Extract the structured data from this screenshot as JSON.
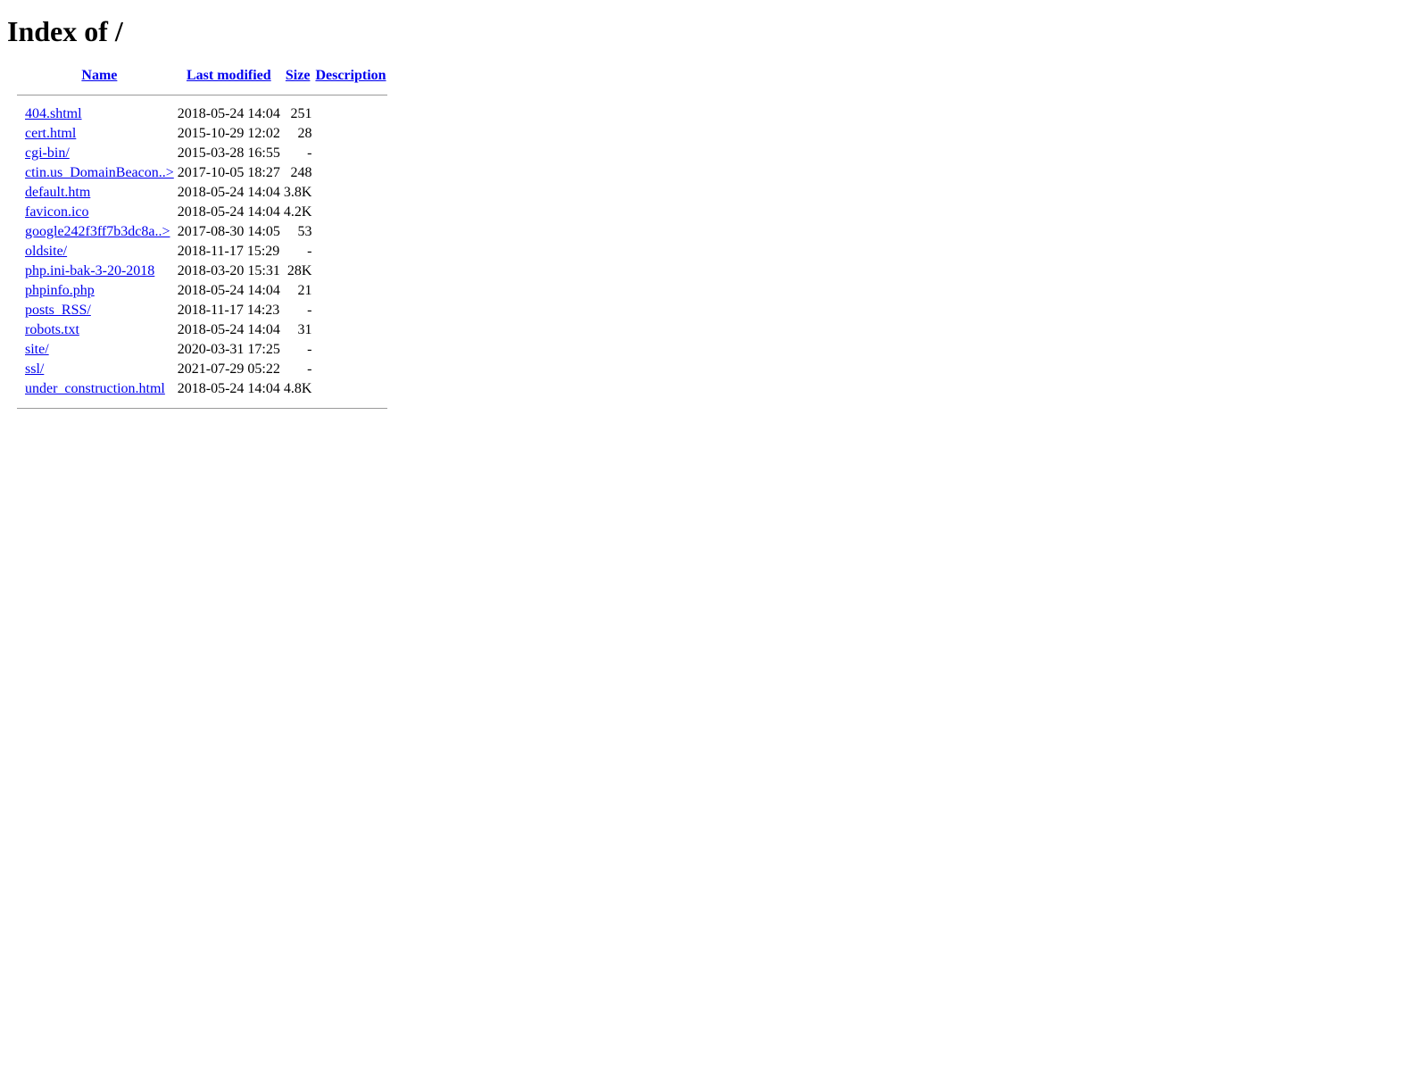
{
  "page": {
    "title": "Index of /"
  },
  "table": {
    "headers": {
      "name": "Name",
      "last_modified": "Last modified",
      "size": "Size",
      "description": "Description"
    },
    "rows": [
      {
        "name": "404.shtml",
        "modified": "2018-05-24 14:04",
        "size": "251",
        "description": ""
      },
      {
        "name": "cert.html",
        "modified": "2015-10-29 12:02",
        "size": "28",
        "description": ""
      },
      {
        "name": "cgi-bin/",
        "modified": "2015-03-28 16:55",
        "size": "-",
        "description": ""
      },
      {
        "name": "ctin.us_DomainBeacon..>",
        "modified": "2017-10-05 18:27",
        "size": "248",
        "description": ""
      },
      {
        "name": "default.htm",
        "modified": "2018-05-24 14:04",
        "size": "3.8K",
        "description": ""
      },
      {
        "name": "favicon.ico",
        "modified": "2018-05-24 14:04",
        "size": "4.2K",
        "description": ""
      },
      {
        "name": "google242f3ff7b3dc8a..>",
        "modified": "2017-08-30 14:05",
        "size": "53",
        "description": ""
      },
      {
        "name": "oldsite/",
        "modified": "2018-11-17 15:29",
        "size": "-",
        "description": ""
      },
      {
        "name": "php.ini-bak-3-20-2018",
        "modified": "2018-03-20 15:31",
        "size": "28K",
        "description": ""
      },
      {
        "name": "phpinfo.php",
        "modified": "2018-05-24 14:04",
        "size": "21",
        "description": ""
      },
      {
        "name": "posts_RSS/",
        "modified": "2018-11-17 14:23",
        "size": "-",
        "description": ""
      },
      {
        "name": "robots.txt",
        "modified": "2018-05-24 14:04",
        "size": "31",
        "description": ""
      },
      {
        "name": "site/",
        "modified": "2020-03-31 17:25",
        "size": "-",
        "description": ""
      },
      {
        "name": "ssl/",
        "modified": "2021-07-29 05:22",
        "size": "-",
        "description": ""
      },
      {
        "name": "under_construction.html",
        "modified": "2018-05-24 14:04",
        "size": "4.8K",
        "description": ""
      }
    ]
  },
  "colors": {
    "link": "#0000ee",
    "rule": "#999999"
  }
}
